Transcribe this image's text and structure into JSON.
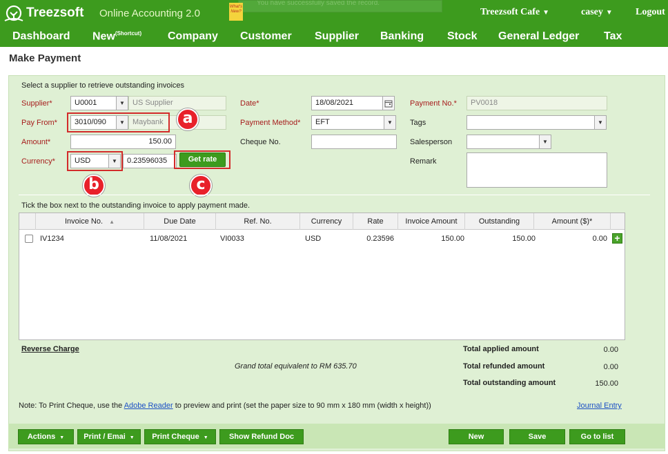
{
  "header": {
    "brand": "Treezsoft",
    "product": "Online Accounting 2.0",
    "whats_new": "What's New?",
    "toast": "You have successfully saved the record.",
    "company": "Treezsoft Cafe",
    "user": "casey",
    "logout": "Logout"
  },
  "nav": {
    "dashboard": "Dashboard",
    "new": "New",
    "new_sup": "(Shortcut)",
    "company": "Company",
    "customer": "Customer",
    "supplier": "Supplier",
    "banking": "Banking",
    "stock": "Stock",
    "general_ledger": "General Ledger",
    "tax": "Tax"
  },
  "page": {
    "title": "Make Payment"
  },
  "form": {
    "intro": "Select a supplier to retrieve outstanding invoices",
    "supplier_label": "Supplier*",
    "supplier_code": "U0001",
    "supplier_name": "US Supplier",
    "payfrom_label": "Pay From*",
    "payfrom_code": "3010/090",
    "payfrom_name": "Maybank",
    "amount_label": "Amount*",
    "amount_value": "150.00",
    "currency_label": "Currency*",
    "currency_value": "USD",
    "rate_value": "0.23596035",
    "get_rate": "Get rate",
    "date_label": "Date*",
    "date_value": "18/08/2021",
    "method_label": "Payment Method*",
    "method_value": "EFT",
    "cheque_label": "Cheque No.",
    "cheque_value": "",
    "paymentno_label": "Payment No.*",
    "paymentno_value": "PV0018",
    "tags_label": "Tags",
    "salesperson_label": "Salesperson",
    "remark_label": "Remark"
  },
  "annotations": {
    "a": "a",
    "b": "b",
    "c": "c"
  },
  "grid": {
    "instruction": "Tick the box next to the outstanding invoice to apply payment made.",
    "columns": [
      "Invoice No.",
      "Due Date",
      "Ref. No.",
      "Currency",
      "Rate",
      "Invoice Amount",
      "Outstanding",
      "Amount ($)*"
    ],
    "sort_indicator": "▲",
    "rows": [
      {
        "invoice": "IV1234",
        "due": "11/08/2021",
        "ref": "VI0033",
        "currency": "USD",
        "rate": "0.23596",
        "invoice_amount": "150.00",
        "outstanding": "150.00",
        "amount": "0.00"
      }
    ]
  },
  "summary": {
    "reverse_charge": "Reverse Charge",
    "grand_total": "Grand total equivalent to RM 635.70",
    "applied_label": "Total applied amount",
    "applied_value": "0.00",
    "refunded_label": "Total refunded amount",
    "refunded_value": "0.00",
    "outstanding_label": "Total outstanding amount",
    "outstanding_value": "150.00",
    "note_prefix": "Note: To Print Cheque, use the ",
    "note_link": "Adobe Reader",
    "note_suffix": " to preview and print (set the paper size to 90 mm x 180 mm (width x height))",
    "journal_entry": "Journal Entry"
  },
  "footer": {
    "actions": "Actions",
    "print_email": "Print / Emai",
    "print_cheque": "Print Cheque",
    "show_refund": "Show Refund Doc",
    "new": "New",
    "save": "Save",
    "go_to_list": "Go to list"
  },
  "colors": {
    "brand_green": "#3d9b1e",
    "panel_green": "#dff0d4",
    "required_red": "#a61c1c",
    "annotation_red": "#e8202a"
  },
  "icons": {
    "logo": "tree-logo-icon",
    "dropdown": "chevron-down-icon",
    "calendar": "calendar-icon",
    "add": "plus-icon"
  }
}
